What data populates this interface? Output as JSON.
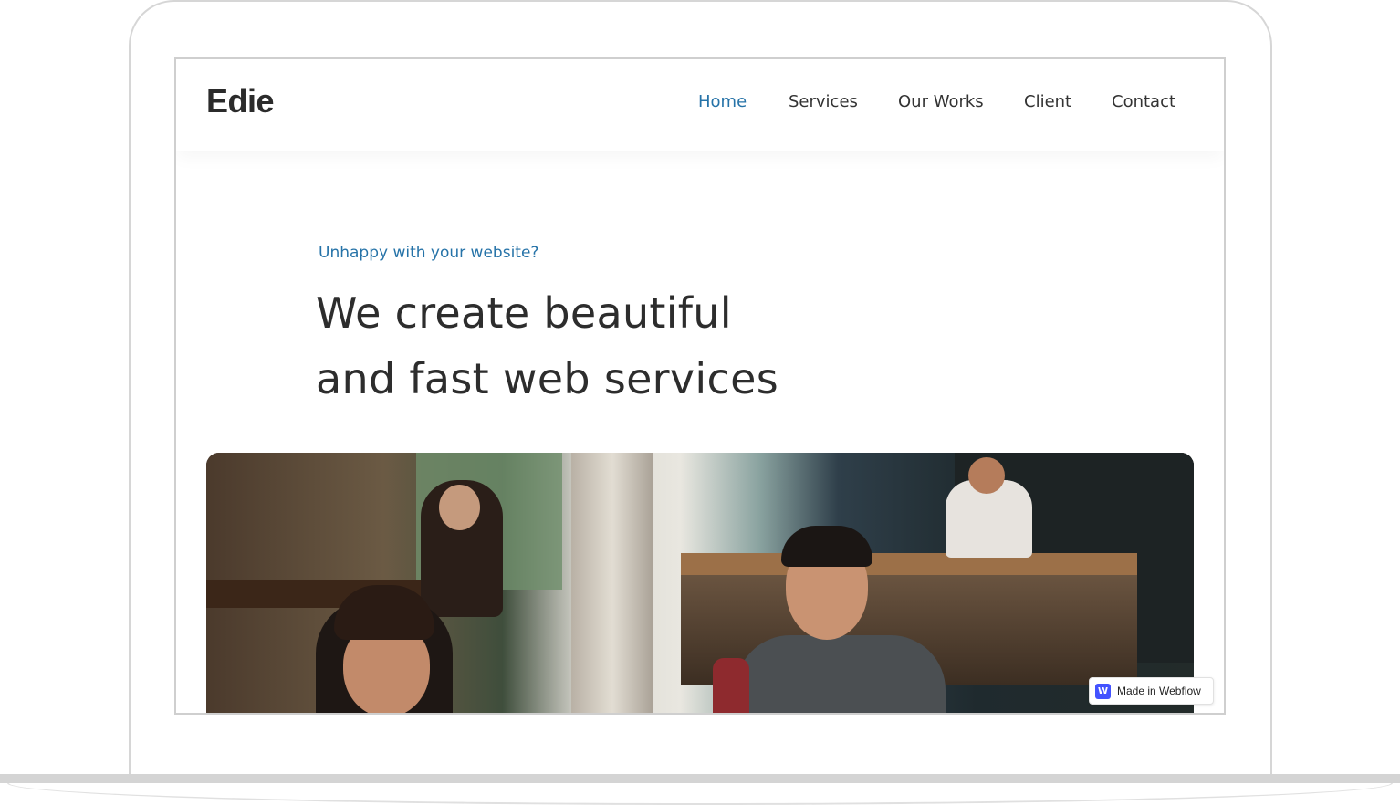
{
  "site": {
    "logo": "Edie",
    "nav": {
      "items": [
        {
          "label": "Home",
          "active": true
        },
        {
          "label": "Services",
          "active": false
        },
        {
          "label": "Our Works",
          "active": false
        },
        {
          "label": "Client",
          "active": false
        },
        {
          "label": "Contact",
          "active": false
        }
      ]
    },
    "hero": {
      "eyebrow": "Unhappy with your website?",
      "title_line_1": "We create beautiful",
      "title_line_2": "and fast web services",
      "image_description": "hero-photo-cafe"
    },
    "badge": {
      "icon": "webflow-w-icon",
      "icon_glyph": "W",
      "label": "Made in Webflow"
    }
  },
  "colors": {
    "accent": "#2673a8",
    "text_dark": "#2d2d2d",
    "webflow_blue": "#4353ff"
  }
}
